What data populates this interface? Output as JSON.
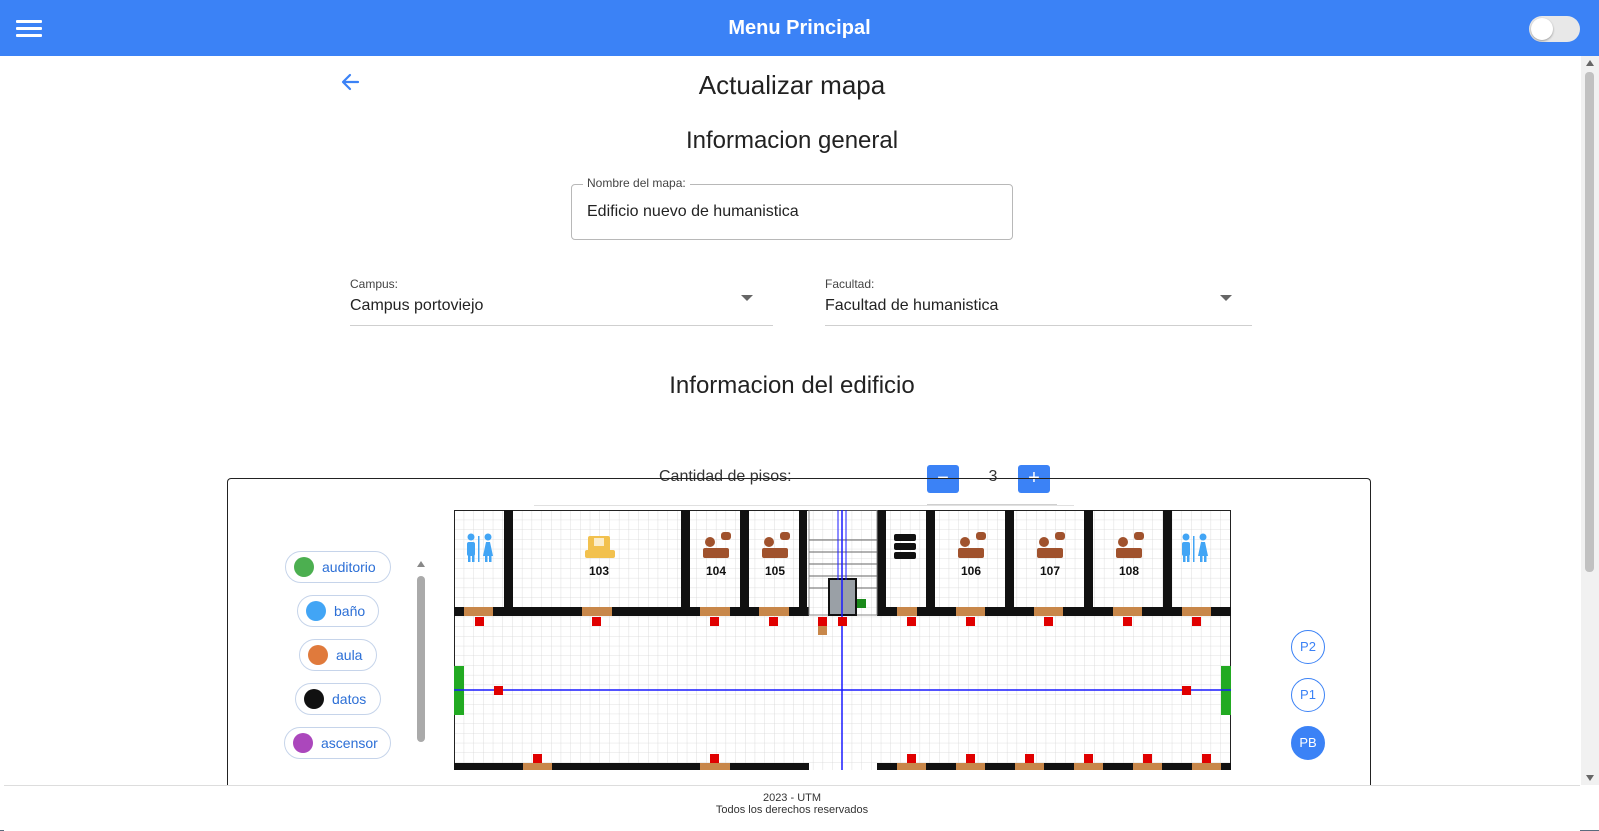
{
  "appbar": {
    "title": "Menu Principal"
  },
  "page": {
    "title": "Actualizar mapa",
    "section_general": "Informacion general",
    "section_building": "Informacion del edificio"
  },
  "form": {
    "map_name_label": "Nombre del mapa:",
    "map_name_value": "Edificio nuevo de humanistica",
    "campus_label": "Campus:",
    "campus_value": "Campus portoviejo",
    "faculty_label": "Facultad:",
    "faculty_value": "Facultad de humanistica",
    "floors_label": "Cantidad de pisos:",
    "floors_value": "3",
    "minus_label": "−",
    "plus_label": "+"
  },
  "legend": {
    "items": [
      {
        "label": "auditorio",
        "icon": "auditorium-icon",
        "color": "#4caf50"
      },
      {
        "label": "baño",
        "icon": "restroom-icon",
        "color": "#42a5f5"
      },
      {
        "label": "aula",
        "icon": "classroom-icon",
        "color": "#e07a3c"
      },
      {
        "label": "datos",
        "icon": "server-icon",
        "color": "#111111"
      },
      {
        "label": "ascensor",
        "icon": "elevator-icon",
        "color": "#ab47bc"
      }
    ]
  },
  "map": {
    "rooms": [
      "103",
      "104",
      "105",
      "106",
      "107",
      "108"
    ],
    "floors": [
      {
        "label": "P2",
        "active": false
      },
      {
        "label": "P1",
        "active": false
      },
      {
        "label": "PB",
        "active": true
      }
    ]
  },
  "footer": {
    "line1": "2023 - UTM",
    "line2": "Todos los derechos reservados"
  },
  "colors": {
    "primary": "#3b82f6",
    "wall": "#111111",
    "door": "#c8874a",
    "marker": "#e00000",
    "path": "#1a1aff",
    "exit": "#22aa22"
  }
}
